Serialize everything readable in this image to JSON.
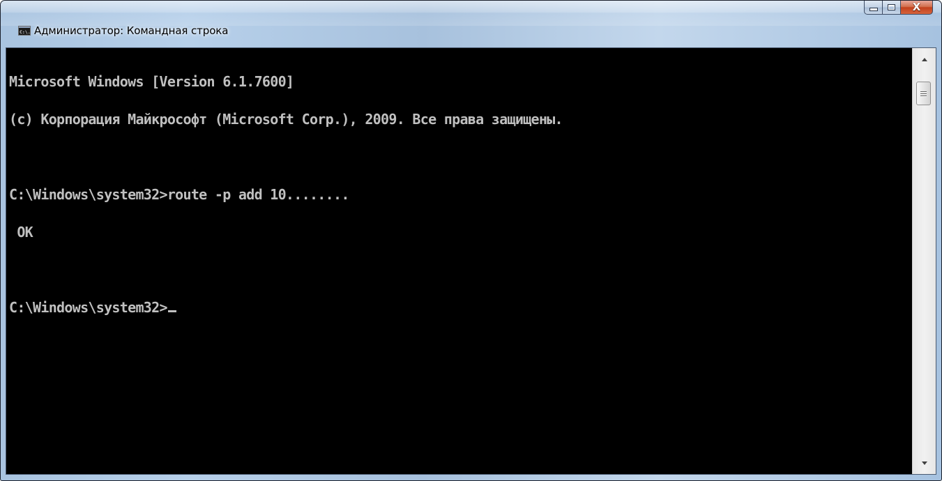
{
  "window": {
    "title": "Администратор: Командная строка",
    "icon": "cmd-icon",
    "icon_text": "C:\\.",
    "buttons": {
      "minimize": "minimize-icon",
      "maximize": "maximize-icon",
      "close": "close-icon",
      "close_glyph": "X"
    }
  },
  "console": {
    "lines": [
      "Microsoft Windows [Version 6.1.7600]",
      "(c) Корпорация Майкрософт (Microsoft Corp.), 2009. Все права защищены.",
      "",
      "C:\\Windows\\system32>route -p add 10........",
      " OK",
      "",
      "C:\\Windows\\system32>"
    ],
    "text_color": "#c0c0c0",
    "background": "#000000"
  },
  "scrollbar": {
    "up": "scroll-up-arrow-icon",
    "down": "scroll-down-arrow-icon",
    "thumb_position": 0
  }
}
